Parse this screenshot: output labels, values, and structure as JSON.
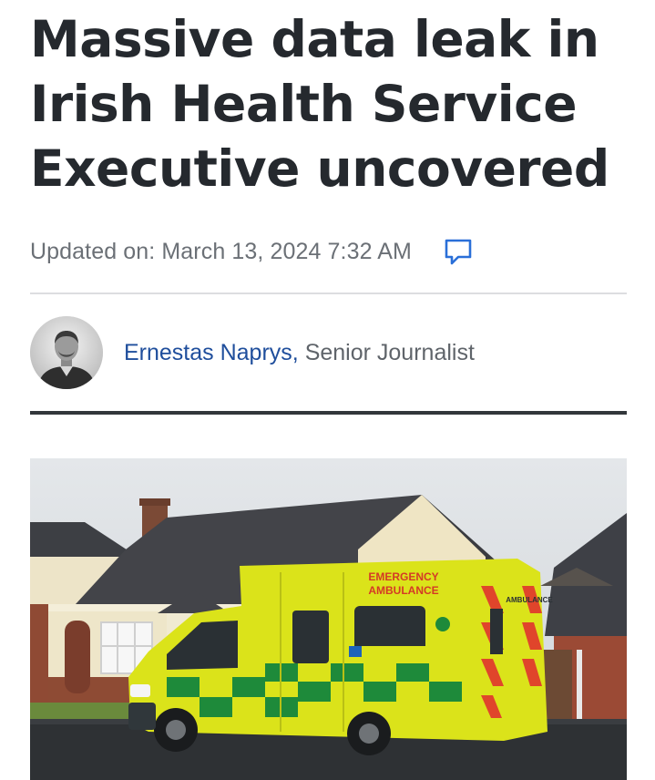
{
  "article": {
    "headline": "Massive data leak in Irish Health Service Executive uncovered",
    "updated": "Updated on: March 13, 2024 7:32 AM",
    "author": {
      "name": "Ernestas Naprys,",
      "role": " Senior Journalist"
    },
    "image": {
      "ambulance_text_line1": "EMERGENCY",
      "ambulance_text_line2": "AMBULANCE",
      "side_text": "AMBULANCE"
    }
  },
  "icons": {
    "comment": "comment-icon"
  },
  "colors": {
    "headline": "#25292e",
    "meta": "#6b7076",
    "link": "#1f4e9c",
    "comment_icon": "#2a6fd8",
    "divider": "#32373b",
    "ambulance_yellow": "#d8e41a",
    "ambulance_green": "#1e8a3a"
  }
}
